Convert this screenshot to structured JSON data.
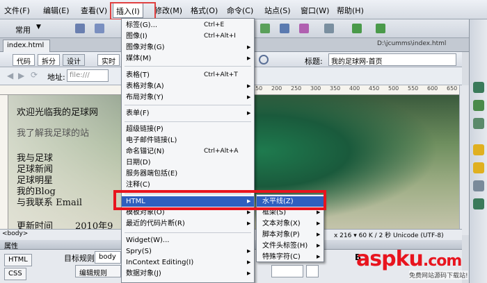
{
  "menubar": {
    "items": [
      "文件(F)",
      "编辑(E)",
      "查看(V)",
      "插入(I)",
      "修改(M)",
      "格式(O)",
      "命令(C)",
      "站点(S)",
      "窗口(W)",
      "帮助(H)"
    ]
  },
  "toolbar": {
    "category": "常用"
  },
  "document": {
    "tab": "index.html",
    "path": "D:\\jcumms\\index.html"
  },
  "viewbar": {
    "code": "代码",
    "split": "拆分",
    "design": "设计",
    "live": "实时",
    "title_label": "标题:",
    "title_value": "我的足球网-首页"
  },
  "addressbar": {
    "label": "地址:",
    "value": "file:///"
  },
  "ruler": {
    "marks": [
      "150",
      "200",
      "250",
      "300",
      "350",
      "400",
      "450",
      "500",
      "550",
      "600",
      "650"
    ]
  },
  "page": {
    "line1": "欢迎光临我的足球网",
    "line2": "我了解我足球的站",
    "nav": [
      "我与足球",
      "足球新闻",
      "足球明星",
      "我的Blog",
      "与我联系 Email"
    ],
    "update": "更新时间",
    "year": "2010年9"
  },
  "status": {
    "tag": "<body>",
    "info": "x 216 ▾ 60 K / 2 秒 Unicode (UTF-8)"
  },
  "properties": {
    "header": "属性",
    "html_btn": "HTML",
    "css_btn": "CSS",
    "rule_label": "目标规则",
    "rule_value": "body",
    "edit_rule": "编辑规则",
    "bold": "B"
  },
  "insert_menu": {
    "items": [
      {
        "label": "标签(G)...",
        "shortcut": "Ctrl+E",
        "arrow": ""
      },
      {
        "label": "图像(I)",
        "shortcut": "Ctrl+Alt+I",
        "arrow": ""
      },
      {
        "label": "图像对象(G)",
        "shortcut": "",
        "arrow": "▶"
      },
      {
        "label": "媒体(M)",
        "shortcut": "",
        "arrow": "▶"
      },
      {
        "label": "表格(T)",
        "shortcut": "Ctrl+Alt+T",
        "arrow": ""
      },
      {
        "label": "表格对象(A)",
        "shortcut": "",
        "arrow": "▶"
      },
      {
        "label": "布局对象(Y)",
        "shortcut": "",
        "arrow": "▶"
      },
      {
        "label": "表单(F)",
        "shortcut": "",
        "arrow": "▶"
      },
      {
        "label": "超级链接(P)",
        "shortcut": "",
        "arrow": ""
      },
      {
        "label": "电子邮件链接(L)",
        "shortcut": "",
        "arrow": ""
      },
      {
        "label": "命名锚记(N)",
        "shortcut": "Ctrl+Alt+A",
        "arrow": ""
      },
      {
        "label": "日期(D)",
        "shortcut": "",
        "arrow": ""
      },
      {
        "label": "服务器端包括(E)",
        "shortcut": "",
        "arrow": ""
      },
      {
        "label": "注释(C)",
        "shortcut": "",
        "arrow": ""
      },
      {
        "label": "HTML",
        "shortcut": "",
        "arrow": "▶"
      },
      {
        "label": "模板对象(O)",
        "shortcut": "",
        "arrow": "▶"
      },
      {
        "label": "最近的代码片断(R)",
        "shortcut": "",
        "arrow": "▶"
      },
      {
        "label": "Widget(W)...",
        "shortcut": "",
        "arrow": ""
      },
      {
        "label": "Spry(S)",
        "shortcut": "",
        "arrow": "▶"
      },
      {
        "label": "InContext Editing(I)",
        "shortcut": "",
        "arrow": "▶"
      },
      {
        "label": "数据对象(J)",
        "shortcut": "",
        "arrow": "▶"
      }
    ]
  },
  "html_submenu": {
    "items": [
      "水平线(Z)",
      "框架(S)",
      "文本对象(X)",
      "脚本对象(P)",
      "文件头标签(H)",
      "特殊字符(C)"
    ]
  },
  "watermark": {
    "brand": "aspku",
    "dot": ".",
    "suffix": "com",
    "sub": "免费网站源码下载站!"
  },
  "colors": {
    "highlight": "#2f5fbf",
    "annotation": "#e8141e"
  }
}
